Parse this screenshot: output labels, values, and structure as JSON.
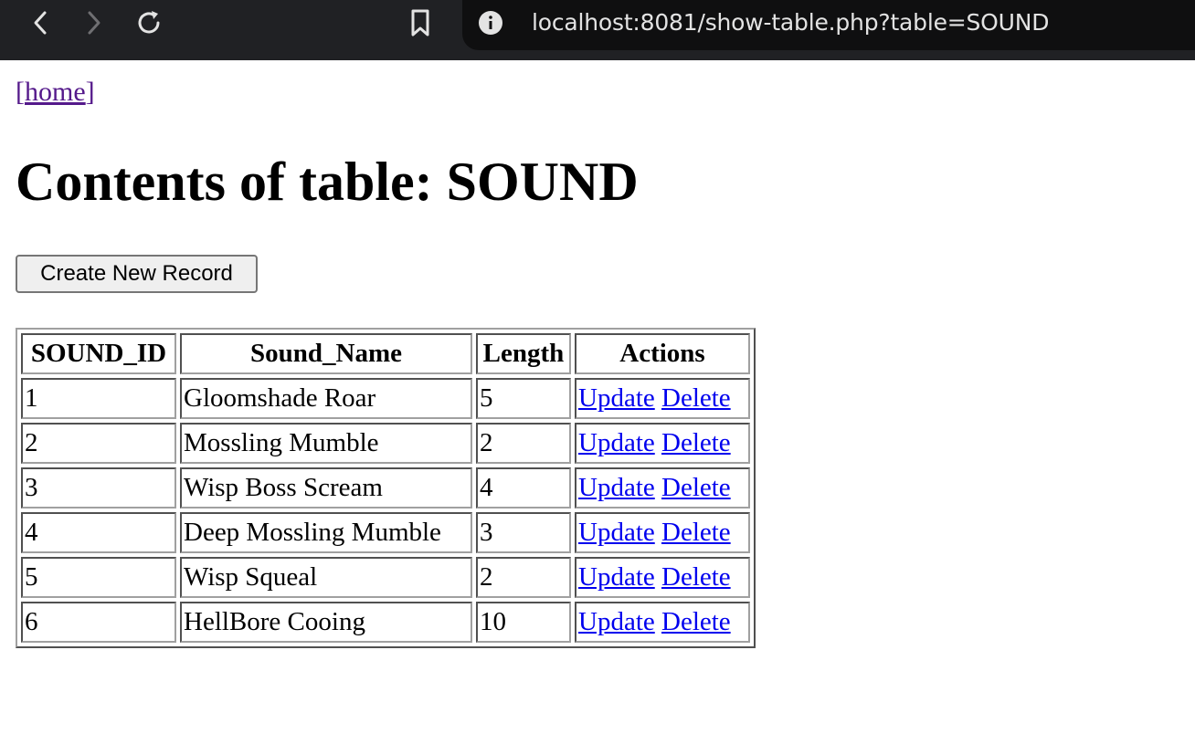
{
  "browser": {
    "url": "localhost:8081/show-table.php?table=SOUND",
    "icons": [
      "back-icon",
      "forward-icon",
      "reload-icon",
      "bookmark-icon",
      "info-icon"
    ]
  },
  "page": {
    "home_prefix": "[",
    "home_link": "home",
    "home_suffix": "]",
    "title": "Contents of table: SOUND",
    "create_button": "Create New Record"
  },
  "table": {
    "headers": [
      "SOUND_ID",
      "Sound_Name",
      "Length",
      "Actions"
    ],
    "rows": [
      {
        "id": "1",
        "name": "Gloomshade Roar",
        "length": "5"
      },
      {
        "id": "2",
        "name": "Mossling Mumble",
        "length": "2"
      },
      {
        "id": "3",
        "name": "Wisp Boss Scream",
        "length": "4"
      },
      {
        "id": "4",
        "name": "Deep Mossling Mumble",
        "length": "3"
      },
      {
        "id": "5",
        "name": "Wisp Squeal",
        "length": "2"
      },
      {
        "id": "6",
        "name": "HellBore Cooing",
        "length": "10"
      }
    ],
    "update_label": "Update",
    "delete_label": "Delete"
  }
}
